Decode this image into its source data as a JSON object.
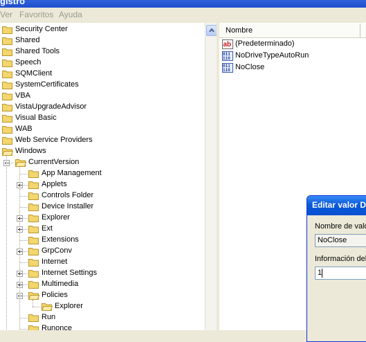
{
  "window": {
    "title": "gistro"
  },
  "menu": [
    "Ver",
    "Favoritos",
    "Ayuda"
  ],
  "tree": {
    "items": [
      {
        "label": "Security Center",
        "level": 0,
        "expander": "none",
        "open": false
      },
      {
        "label": "Shared",
        "level": 0,
        "expander": "none",
        "open": false
      },
      {
        "label": "Shared Tools",
        "level": 0,
        "expander": "none",
        "open": false
      },
      {
        "label": "Speech",
        "level": 0,
        "expander": "none",
        "open": false
      },
      {
        "label": "SQMClient",
        "level": 0,
        "expander": "none",
        "open": false
      },
      {
        "label": "SystemCertificates",
        "level": 0,
        "expander": "none",
        "open": false
      },
      {
        "label": "VBA",
        "level": 0,
        "expander": "none",
        "open": false
      },
      {
        "label": "VistaUpgradeAdvisor",
        "level": 0,
        "expander": "none",
        "open": false
      },
      {
        "label": "Visual Basic",
        "level": 0,
        "expander": "none",
        "open": false
      },
      {
        "label": "WAB",
        "level": 0,
        "expander": "none",
        "open": false
      },
      {
        "label": "Web Service Providers",
        "level": 0,
        "expander": "none",
        "open": false
      },
      {
        "label": "Windows",
        "level": 0,
        "expander": "none",
        "open": true
      },
      {
        "label": "CurrentVersion",
        "level": 1,
        "expander": "minus",
        "open": true
      },
      {
        "label": "App Management",
        "level": 2,
        "expander": "none",
        "open": false
      },
      {
        "label": "Applets",
        "level": 2,
        "expander": "plus",
        "open": false
      },
      {
        "label": "Controls Folder",
        "level": 2,
        "expander": "none",
        "open": false
      },
      {
        "label": "Device Installer",
        "level": 2,
        "expander": "none",
        "open": false
      },
      {
        "label": "Explorer",
        "level": 2,
        "expander": "plus",
        "open": false
      },
      {
        "label": "Ext",
        "level": 2,
        "expander": "plus",
        "open": false
      },
      {
        "label": "Extensions",
        "level": 2,
        "expander": "none",
        "open": false
      },
      {
        "label": "GrpConv",
        "level": 2,
        "expander": "plus",
        "open": false
      },
      {
        "label": "Internet",
        "level": 2,
        "expander": "none",
        "open": false
      },
      {
        "label": "Internet Settings",
        "level": 2,
        "expander": "plus",
        "open": false
      },
      {
        "label": "Multimedia",
        "level": 2,
        "expander": "plus",
        "open": false
      },
      {
        "label": "Policies",
        "level": 2,
        "expander": "minus",
        "open": true
      },
      {
        "label": "Explorer",
        "level": 3,
        "expander": "none",
        "open": true
      },
      {
        "label": "Run",
        "level": 2,
        "expander": "none",
        "open": false
      },
      {
        "label": "Runonce",
        "level": 2,
        "expander": "none",
        "open": false
      }
    ]
  },
  "list": {
    "column_header": "Nombre",
    "rows": [
      {
        "name": "(Predeterminado)",
        "icon": "string-value-icon"
      },
      {
        "name": "NoDriveTypeAutoRun",
        "icon": "binary-value-icon"
      },
      {
        "name": "NoClose",
        "icon": "binary-value-icon"
      }
    ]
  },
  "dialog": {
    "title": "Editar valor D",
    "name_label": "Nombre de valo",
    "name_value": "NoClose",
    "data_label": "Información del",
    "data_value": "1"
  },
  "colors": {
    "folder": "#f3d66e",
    "folder_edge": "#b9962c",
    "titlebar": "#0a5ad8"
  }
}
